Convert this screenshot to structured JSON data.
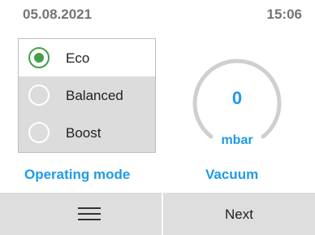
{
  "status": {
    "date": "05.08.2021",
    "time": "15:06"
  },
  "modes": [
    {
      "label": "Eco",
      "selected": true
    },
    {
      "label": "Balanced",
      "selected": false
    },
    {
      "label": "Boost",
      "selected": false
    }
  ],
  "gauge": {
    "value": "0",
    "unit": "mbar"
  },
  "captions": {
    "mode": "Operating mode",
    "vacuum": "Vacuum"
  },
  "footer": {
    "menu_icon": "menu-icon",
    "next_label": "Next"
  },
  "colors": {
    "accent": "#1e9be6",
    "selected": "#43a047",
    "bar": "#dedede"
  }
}
